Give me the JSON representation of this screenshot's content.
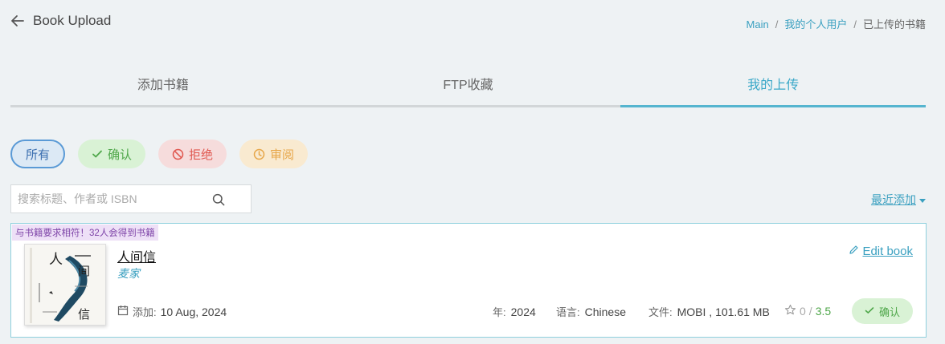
{
  "header": {
    "title": "Book Upload"
  },
  "breadcrumb": [
    {
      "label": "Main"
    },
    {
      "label": "我的个人用户"
    },
    {
      "label": "已上传的书籍"
    }
  ],
  "tabs": [
    {
      "label": "添加书籍"
    },
    {
      "label": "FTP收藏"
    },
    {
      "label": "我的上传"
    }
  ],
  "filters": [
    {
      "label": "所有",
      "icon": ""
    },
    {
      "label": "确认",
      "icon": "check-icon"
    },
    {
      "label": "拒绝",
      "icon": "ban-icon"
    },
    {
      "label": "审阅",
      "icon": "clock-icon"
    }
  ],
  "search": {
    "placeholder": "搜索标题、作者或 ISBN"
  },
  "sort": {
    "label": "最近添加"
  },
  "book": {
    "promo": "与书籍要求相符！32人会得到书籍",
    "title": "人间信",
    "author": "麦家",
    "cover_text": [
      "人",
      "间",
      "信"
    ],
    "added_label": "添加:",
    "added_date": "10 Aug, 2024",
    "year_label": "年:",
    "year": "2024",
    "lang_label": "语言:",
    "lang": "Chinese",
    "file_label": "文件:",
    "file": "MOBI , 101.61 MB",
    "rating_current": "0",
    "rating_sep": "/",
    "rating_max": "3.5",
    "status": "确认",
    "edit_label": "Edit book"
  },
  "colors": {
    "accent": "#3aa0c0",
    "ok": "#4fa74a",
    "reject": "#e0574f",
    "review": "#e7a74a"
  }
}
